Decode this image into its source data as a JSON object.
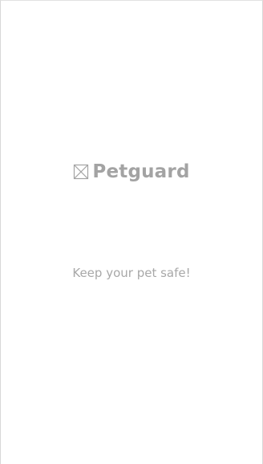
{
  "app": {
    "logo": {
      "icon": "broken-image-icon",
      "name": "Petguard"
    },
    "tagline": "Keep your pet safe!"
  }
}
